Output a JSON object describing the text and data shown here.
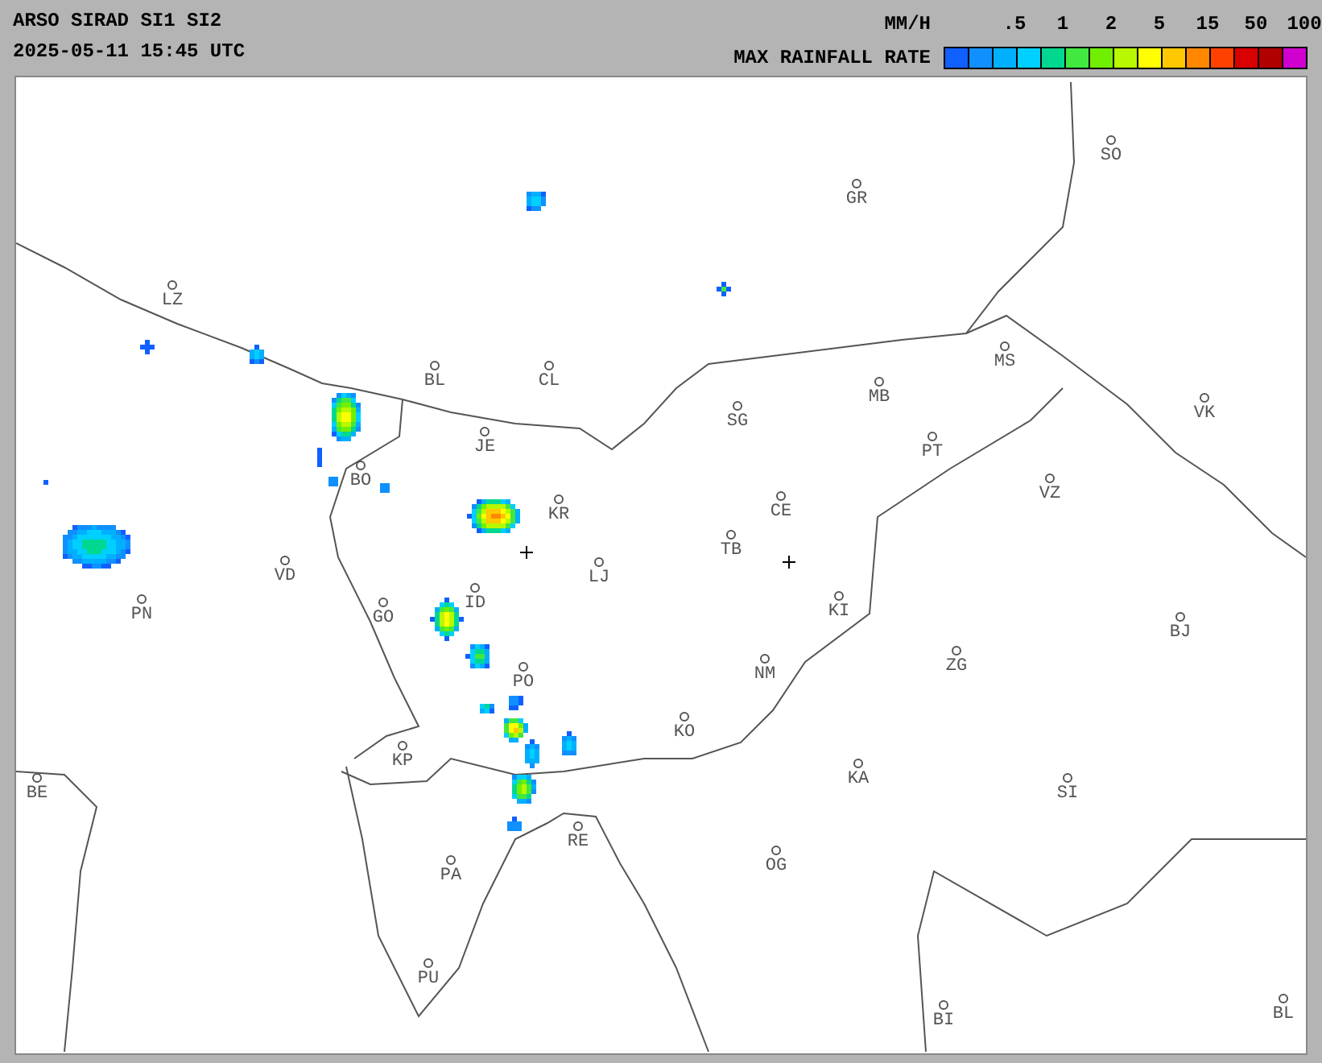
{
  "header": {
    "title": "ARSO SIRAD SI1 SI2",
    "timestamp": "2025-05-11 15:45 UTC"
  },
  "legend": {
    "unit": "MM/H",
    "title": "MAX RAINFALL RATE",
    "ticks": [
      ".5",
      "1",
      "2",
      "5",
      "15",
      "50",
      "100"
    ],
    "swatches": [
      {
        "color": "#1060ff"
      },
      {
        "color": "#1090ff"
      },
      {
        "color": "#00b0ff"
      },
      {
        "color": "#00d0ff"
      },
      {
        "color": "#00d890"
      },
      {
        "color": "#40e840"
      },
      {
        "color": "#70f000"
      },
      {
        "color": "#b8f800"
      },
      {
        "color": "#ffff00"
      },
      {
        "color": "#ffc800"
      },
      {
        "color": "#ff8800"
      },
      {
        "color": "#ff4000"
      },
      {
        "color": "#d80000"
      },
      {
        "color": "#b00000"
      },
      {
        "color": "#d000d0"
      }
    ]
  },
  "map": {
    "cities": [
      "SO",
      "GR",
      "LZ",
      "MS",
      "BL",
      "CL",
      "MB",
      "SG",
      "VK",
      "JE",
      "PT",
      "BO",
      "KR",
      "CE",
      "VZ",
      "TB",
      "VD",
      "LJ",
      "PN",
      "ID",
      "GO",
      "KI",
      "BJ",
      "ZG",
      "NM",
      "PO",
      "KO",
      "KP",
      "KA",
      "SI",
      "BE",
      "RE",
      "OG",
      "PA",
      "PU",
      "BI",
      "BL"
    ]
  }
}
